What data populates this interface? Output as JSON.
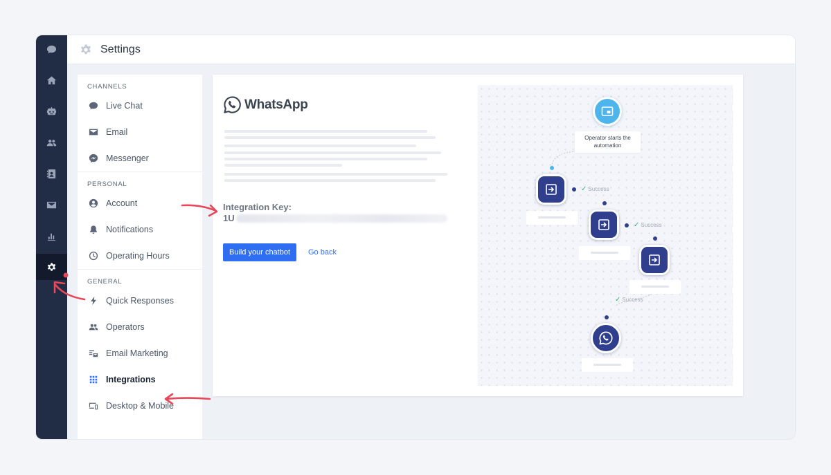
{
  "header": {
    "title": "Settings"
  },
  "colors": {
    "accent": "#2f6ef1",
    "rail": "#212c45",
    "annotation": "#e8475a"
  },
  "rail": {
    "items": [
      {
        "icon": "chat-bubble-icon"
      },
      {
        "icon": "home-icon"
      },
      {
        "icon": "robot-icon"
      },
      {
        "icon": "users-icon"
      },
      {
        "icon": "contacts-book-icon"
      },
      {
        "icon": "mail-icon"
      },
      {
        "icon": "bar-chart-icon"
      },
      {
        "icon": "gear-icon",
        "active": true
      }
    ]
  },
  "menu": {
    "channels_label": "CHANNELS",
    "channels": [
      {
        "label": "Live Chat",
        "icon": "chat-bubble-icon"
      },
      {
        "label": "Email",
        "icon": "envelope-icon"
      },
      {
        "label": "Messenger",
        "icon": "messenger-icon"
      }
    ],
    "personal_label": "PERSONAL",
    "personal": [
      {
        "label": "Account",
        "icon": "account-icon"
      },
      {
        "label": "Notifications",
        "icon": "bell-icon"
      },
      {
        "label": "Operating Hours",
        "icon": "clock-icon"
      }
    ],
    "general_label": "GENERAL",
    "general": [
      {
        "label": "Quick Responses",
        "icon": "lightning-icon"
      },
      {
        "label": "Operators",
        "icon": "users-icon"
      },
      {
        "label": "Email Marketing",
        "icon": "email-marketing-icon"
      },
      {
        "label": "Integrations",
        "icon": "grid-icon",
        "active": true
      },
      {
        "label": "Desktop & Mobile",
        "icon": "devices-icon"
      }
    ]
  },
  "integration": {
    "brand": "WhatsApp",
    "key_label": "Integration Key:",
    "key_prefix": "1U",
    "primary_button": "Build your chatbot",
    "secondary_link": "Go back"
  },
  "diagram": {
    "start_text": "Operator starts the automation",
    "success_1": "Success",
    "success_2": "Success",
    "success_3": "Success"
  }
}
